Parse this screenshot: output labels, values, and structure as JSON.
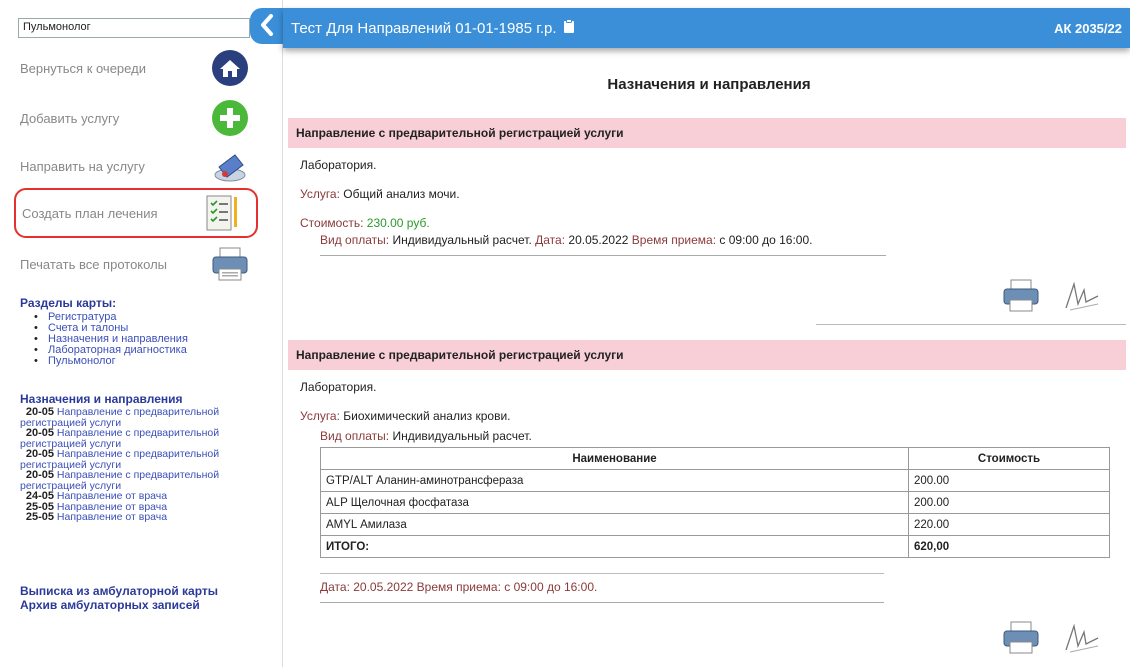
{
  "sidebar": {
    "specialty": "Пульмонолог",
    "actions": {
      "queue": "Вернуться к очереди",
      "add_service": "Добавить услугу",
      "direct_service": "Направить на услугу",
      "create_plan": "Создать план лечения",
      "print_all": "Печатать все протоколы"
    },
    "sections_title": "Разделы карты:",
    "sections": [
      "Регистратура",
      "Счета и талоны",
      "Назначения и направления",
      "Лабораторная диагностика",
      "Пульмонолог"
    ],
    "history_title": "Назначения и направления",
    "history": [
      {
        "date": "20-05",
        "text": "Направление с предварительной регистрацией услуги"
      },
      {
        "date": "20-05",
        "text": "Направление с предварительной регистрацией услуги"
      },
      {
        "date": "20-05",
        "text": "Направление с предварительной регистрацией услуги"
      },
      {
        "date": "20-05",
        "text": "Направление с предварительной регистрацией услуги"
      },
      {
        "date": "24-05",
        "text": "Направление от врача"
      },
      {
        "date": "25-05",
        "text": "Направление от врача"
      },
      {
        "date": "25-05",
        "text": "Направление от врача"
      }
    ],
    "link_extract": "Выписка из амбулаторной карты",
    "link_archive": "Архив амбулаторных записей"
  },
  "header": {
    "patient": "Тест Для Направлений 01-01-1985 г.р.",
    "card_no": "АК 2035/22"
  },
  "main": {
    "title": "Назначения и направления",
    "blocks": [
      {
        "heading": "Направление с предварительной регистрацией услуги",
        "department": "Лаборатория.",
        "service_label": "Услуга:",
        "service": "Общий анализ мочи.",
        "cost_label": "Стоимость:",
        "cost": "230.00 руб.",
        "pay_label": "Вид оплаты:",
        "pay": "Индивидуальный расчет.",
        "date_label": "Дата:",
        "date": "20.05.2022",
        "time_label": "Время приема:",
        "time": "с 09:00 до 16:00."
      },
      {
        "heading": "Направление с предварительной регистрацией услуги",
        "department": "Лаборатория.",
        "service_label": "Услуга:",
        "service": "Биохимический анализ крови.",
        "pay_label": "Вид оплаты:",
        "pay": "Индивидуальный расчет.",
        "table": {
          "headers": [
            "Наименование",
            "Стоимость"
          ],
          "rows": [
            [
              "GTP/ALT Аланин-аминотрансфераза",
              "200.00"
            ],
            [
              "ALP Щелочная фосфатаза",
              "200.00"
            ],
            [
              "AMYL Амилаза",
              "220.00"
            ]
          ],
          "total_label": "ИТОГО:",
          "total": "620,00"
        },
        "date_label": "Дата:",
        "date": "20.05.2022",
        "time_label": "Время приема:",
        "time": "с 09:00 до 16:00."
      }
    ]
  },
  "colors": {
    "header_blue": "#3a8fd8",
    "block_pink": "#f8cfd6",
    "highlight_red": "#e53030",
    "cost_green": "#2a9a2a"
  }
}
